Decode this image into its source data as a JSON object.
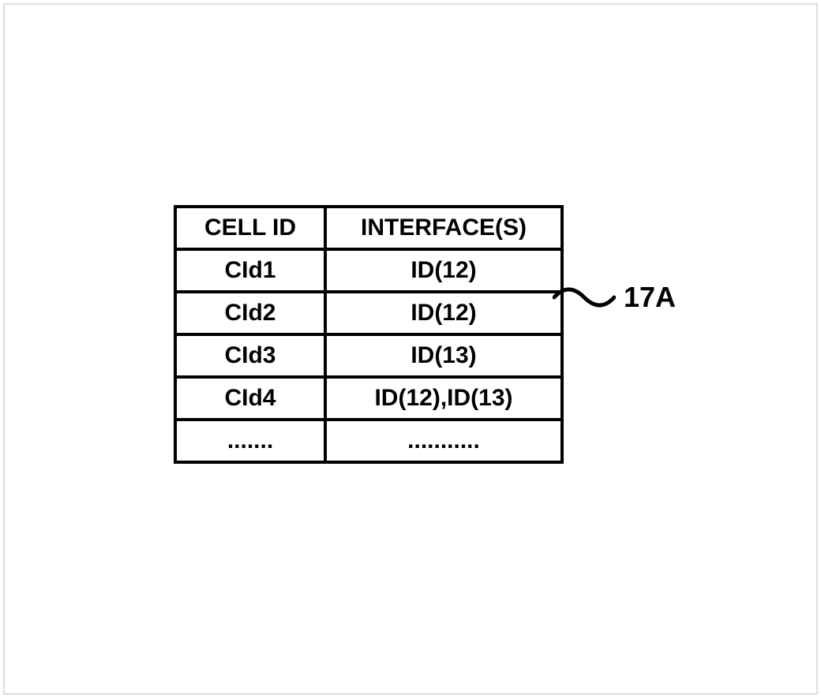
{
  "table": {
    "headers": {
      "col1": "CELL ID",
      "col2": "INTERFACE(S)"
    },
    "rows": [
      {
        "cell_id": "CId1",
        "interfaces": "ID(12)"
      },
      {
        "cell_id": "CId2",
        "interfaces": "ID(12)"
      },
      {
        "cell_id": "CId3",
        "interfaces": "ID(13)"
      },
      {
        "cell_id": "CId4",
        "interfaces": "ID(12),ID(13)"
      },
      {
        "cell_id": ".......",
        "interfaces": "..........."
      }
    ]
  },
  "callout_label": "17A"
}
